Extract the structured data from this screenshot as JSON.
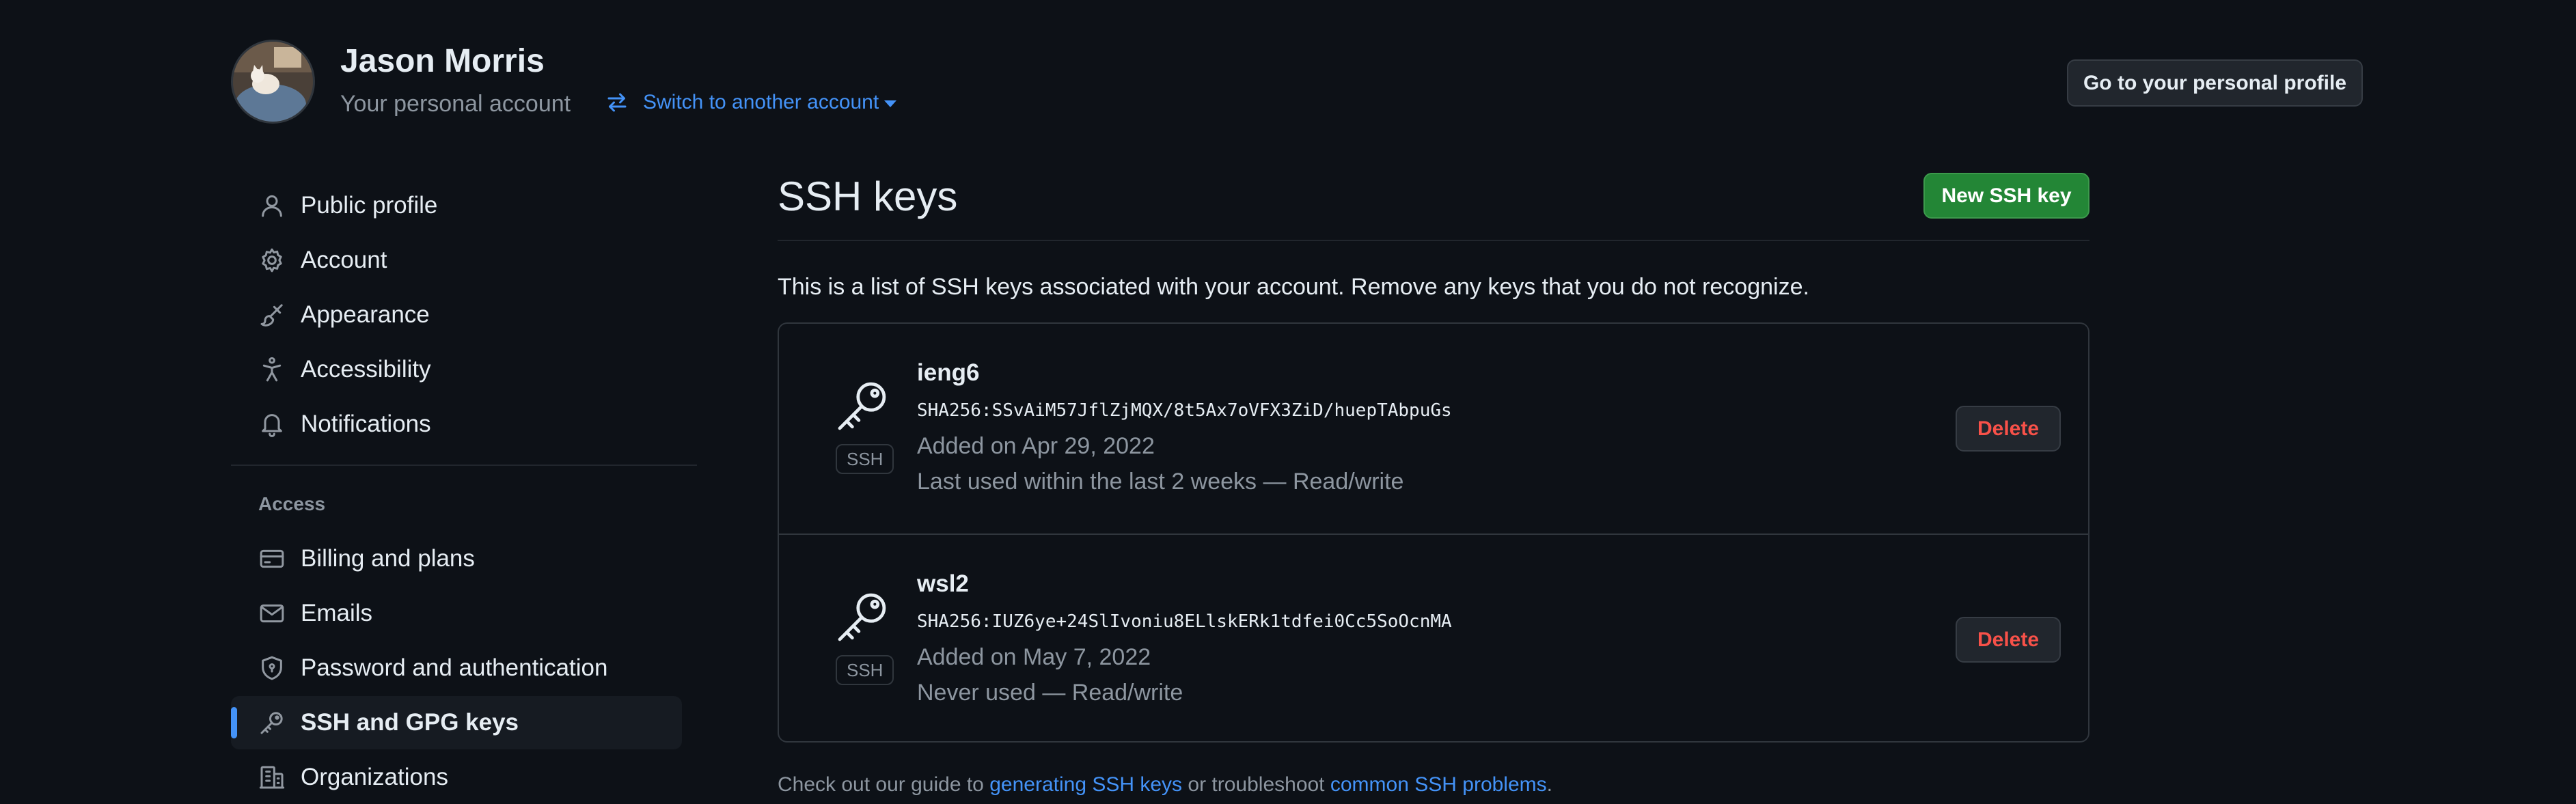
{
  "header": {
    "user_name": "Jason Morris",
    "account_label": "Your personal account",
    "switch_account": "Switch to another account",
    "profile_button": "Go to your personal profile"
  },
  "sidebar": {
    "items": [
      {
        "label": "Public profile",
        "icon": "person-icon"
      },
      {
        "label": "Account",
        "icon": "gear-icon"
      },
      {
        "label": "Appearance",
        "icon": "paintbrush-icon"
      },
      {
        "label": "Accessibility",
        "icon": "accessibility-icon"
      },
      {
        "label": "Notifications",
        "icon": "bell-icon"
      }
    ],
    "access_heading": "Access",
    "access_items": [
      {
        "label": "Billing and plans",
        "icon": "credit-card-icon"
      },
      {
        "label": "Emails",
        "icon": "mail-icon"
      },
      {
        "label": "Password and authentication",
        "icon": "shield-lock-icon"
      },
      {
        "label": "SSH and GPG keys",
        "icon": "key-icon",
        "active": true
      },
      {
        "label": "Organizations",
        "icon": "organization-icon"
      }
    ]
  },
  "main": {
    "title": "SSH keys",
    "new_key_button": "New SSH key",
    "intro": "This is a list of SSH keys associated with your account. Remove any keys that you do not recognize.",
    "keys": [
      {
        "title": "ieng6",
        "badge": "SSH",
        "fingerprint": "SHA256:SSvAiM57JflZjMQX/8t5Ax7oVFX3ZiD/huepTAbpuGs",
        "added": "Added on Apr 29, 2022",
        "last_used": "Last used within the last 2 weeks — Read/write",
        "delete": "Delete"
      },
      {
        "title": "wsl2",
        "badge": "SSH",
        "fingerprint": "SHA256:IUZ6ye+24SlIvoniu8ELlskERk1tdfei0Cc5SoOcnMA",
        "added": "Added on May 7, 2022",
        "last_used": "Never used — Read/write",
        "delete": "Delete"
      }
    ],
    "footer": {
      "prefix": "Check out our guide to",
      "link1": "generating SSH keys",
      "middle": "or troubleshoot",
      "link2": "common SSH problems",
      "suffix": "."
    }
  },
  "colors": {
    "background": "#0d1117",
    "accent": "#4493f8",
    "primary_button": "#238636",
    "danger": "#f85149",
    "muted_text": "#8d96a0"
  }
}
